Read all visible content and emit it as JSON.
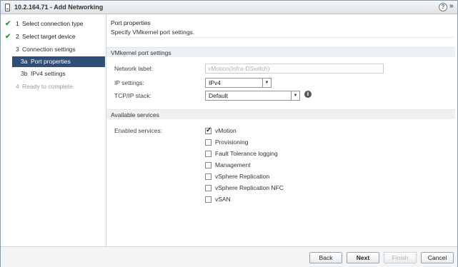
{
  "window": {
    "title": "10.2.164.71 - Add Networking"
  },
  "icons": {
    "title": "host-icon",
    "help": "?",
    "expand": "»"
  },
  "steps": [
    {
      "num": "1",
      "label": "Select connection type",
      "state": "done"
    },
    {
      "num": "2",
      "label": "Select target device",
      "state": "done"
    },
    {
      "num": "3",
      "label": "Connection settings",
      "state": "normal"
    },
    {
      "num": "3a",
      "label": "Port properties",
      "state": "active"
    },
    {
      "num": "3b",
      "label": "IPv4 settings",
      "state": "normal"
    },
    {
      "num": "4",
      "label": "Ready to complete",
      "state": "disabled"
    }
  ],
  "page": {
    "title": "Port properties",
    "subtitle": "Specify VMkernel port settings."
  },
  "vmk_section": {
    "heading": "VMkernel port settings",
    "network_label": {
      "label": "Network label:",
      "value": "vMotion(Infra-DSwitch)"
    },
    "ip_settings": {
      "label": "IP settings:",
      "value": "IPv4"
    },
    "tcpip_stack": {
      "label": "TCP/IP stack:",
      "value": "Default"
    }
  },
  "services_section": {
    "heading": "Available services",
    "label": "Enabled services:",
    "items": [
      {
        "label": "vMotion",
        "checked": true
      },
      {
        "label": "Provisioning",
        "checked": false
      },
      {
        "label": "Fault Tolerance logging",
        "checked": false
      },
      {
        "label": "Management",
        "checked": false
      },
      {
        "label": "vSphere Replication",
        "checked": false
      },
      {
        "label": "vSphere Replication NFC",
        "checked": false
      },
      {
        "label": "vSAN",
        "checked": false
      }
    ]
  },
  "footer": {
    "back": "Back",
    "next": "Next",
    "finish": "Finish",
    "cancel": "Cancel"
  }
}
